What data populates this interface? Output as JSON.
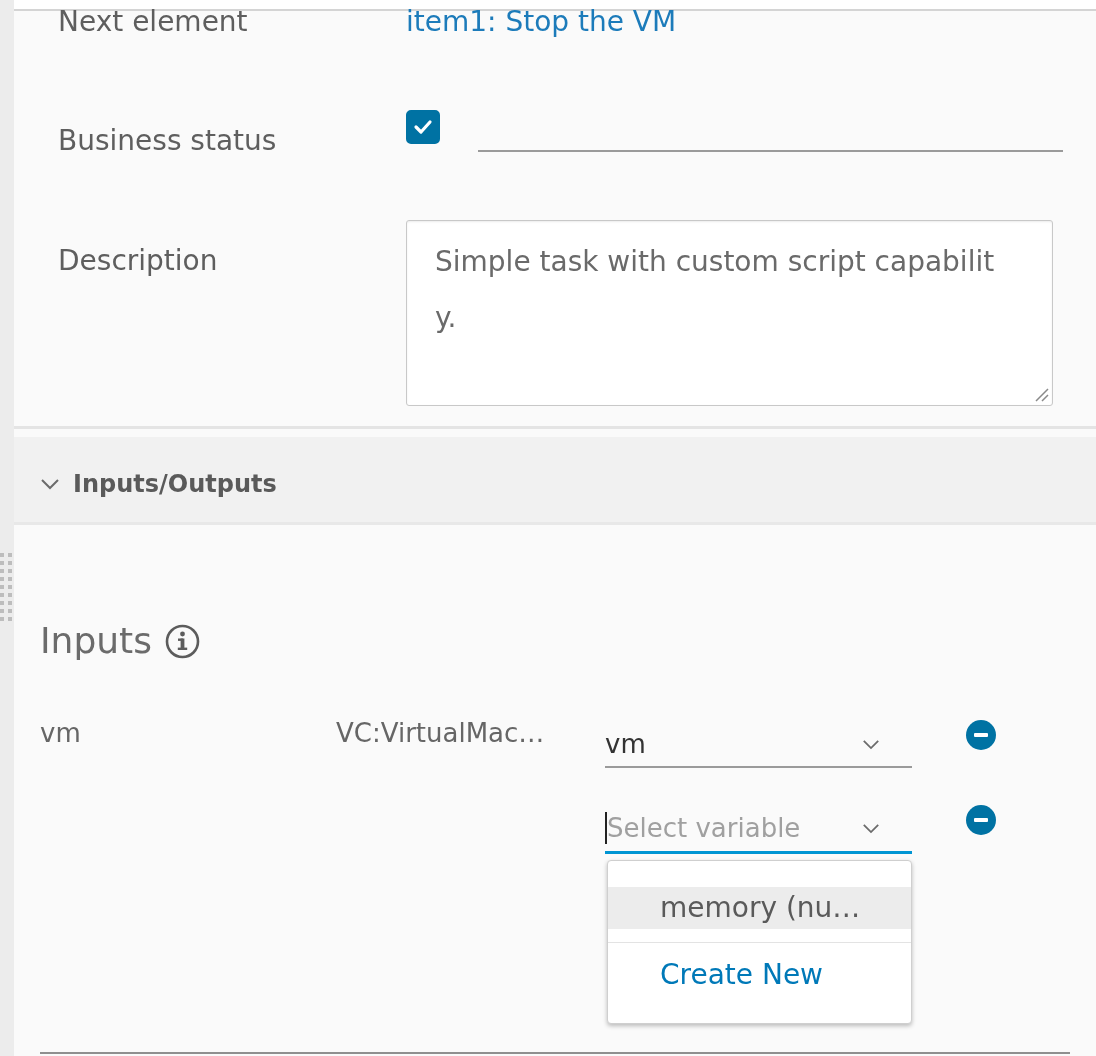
{
  "properties": [
    {
      "kind": "link",
      "label": "Next element",
      "value": "item1: Stop the VM"
    },
    {
      "kind": "checkbox",
      "label": "Business status",
      "checked": true
    },
    {
      "kind": "textarea",
      "label": "Description",
      "value": "Simple task with custom script capability."
    }
  ],
  "io_section": {
    "title": "Inputs/Outputs",
    "expanded": true,
    "inputs": {
      "title": "Inputs",
      "rows": [
        {
          "name": "vm",
          "type": "VC:VirtualMac…",
          "binding": {
            "value": "vm",
            "focused": false,
            "expanded": false
          }
        },
        {
          "binding": {
            "placeholder": "Select variable",
            "focused": true,
            "expanded": true,
            "options": [
              {
                "kind": "option",
                "label": "memory (nu…",
                "selected": true
              },
              {
                "kind": "action",
                "label": "Create New",
                "selected": false
              }
            ]
          }
        }
      ]
    }
  }
}
